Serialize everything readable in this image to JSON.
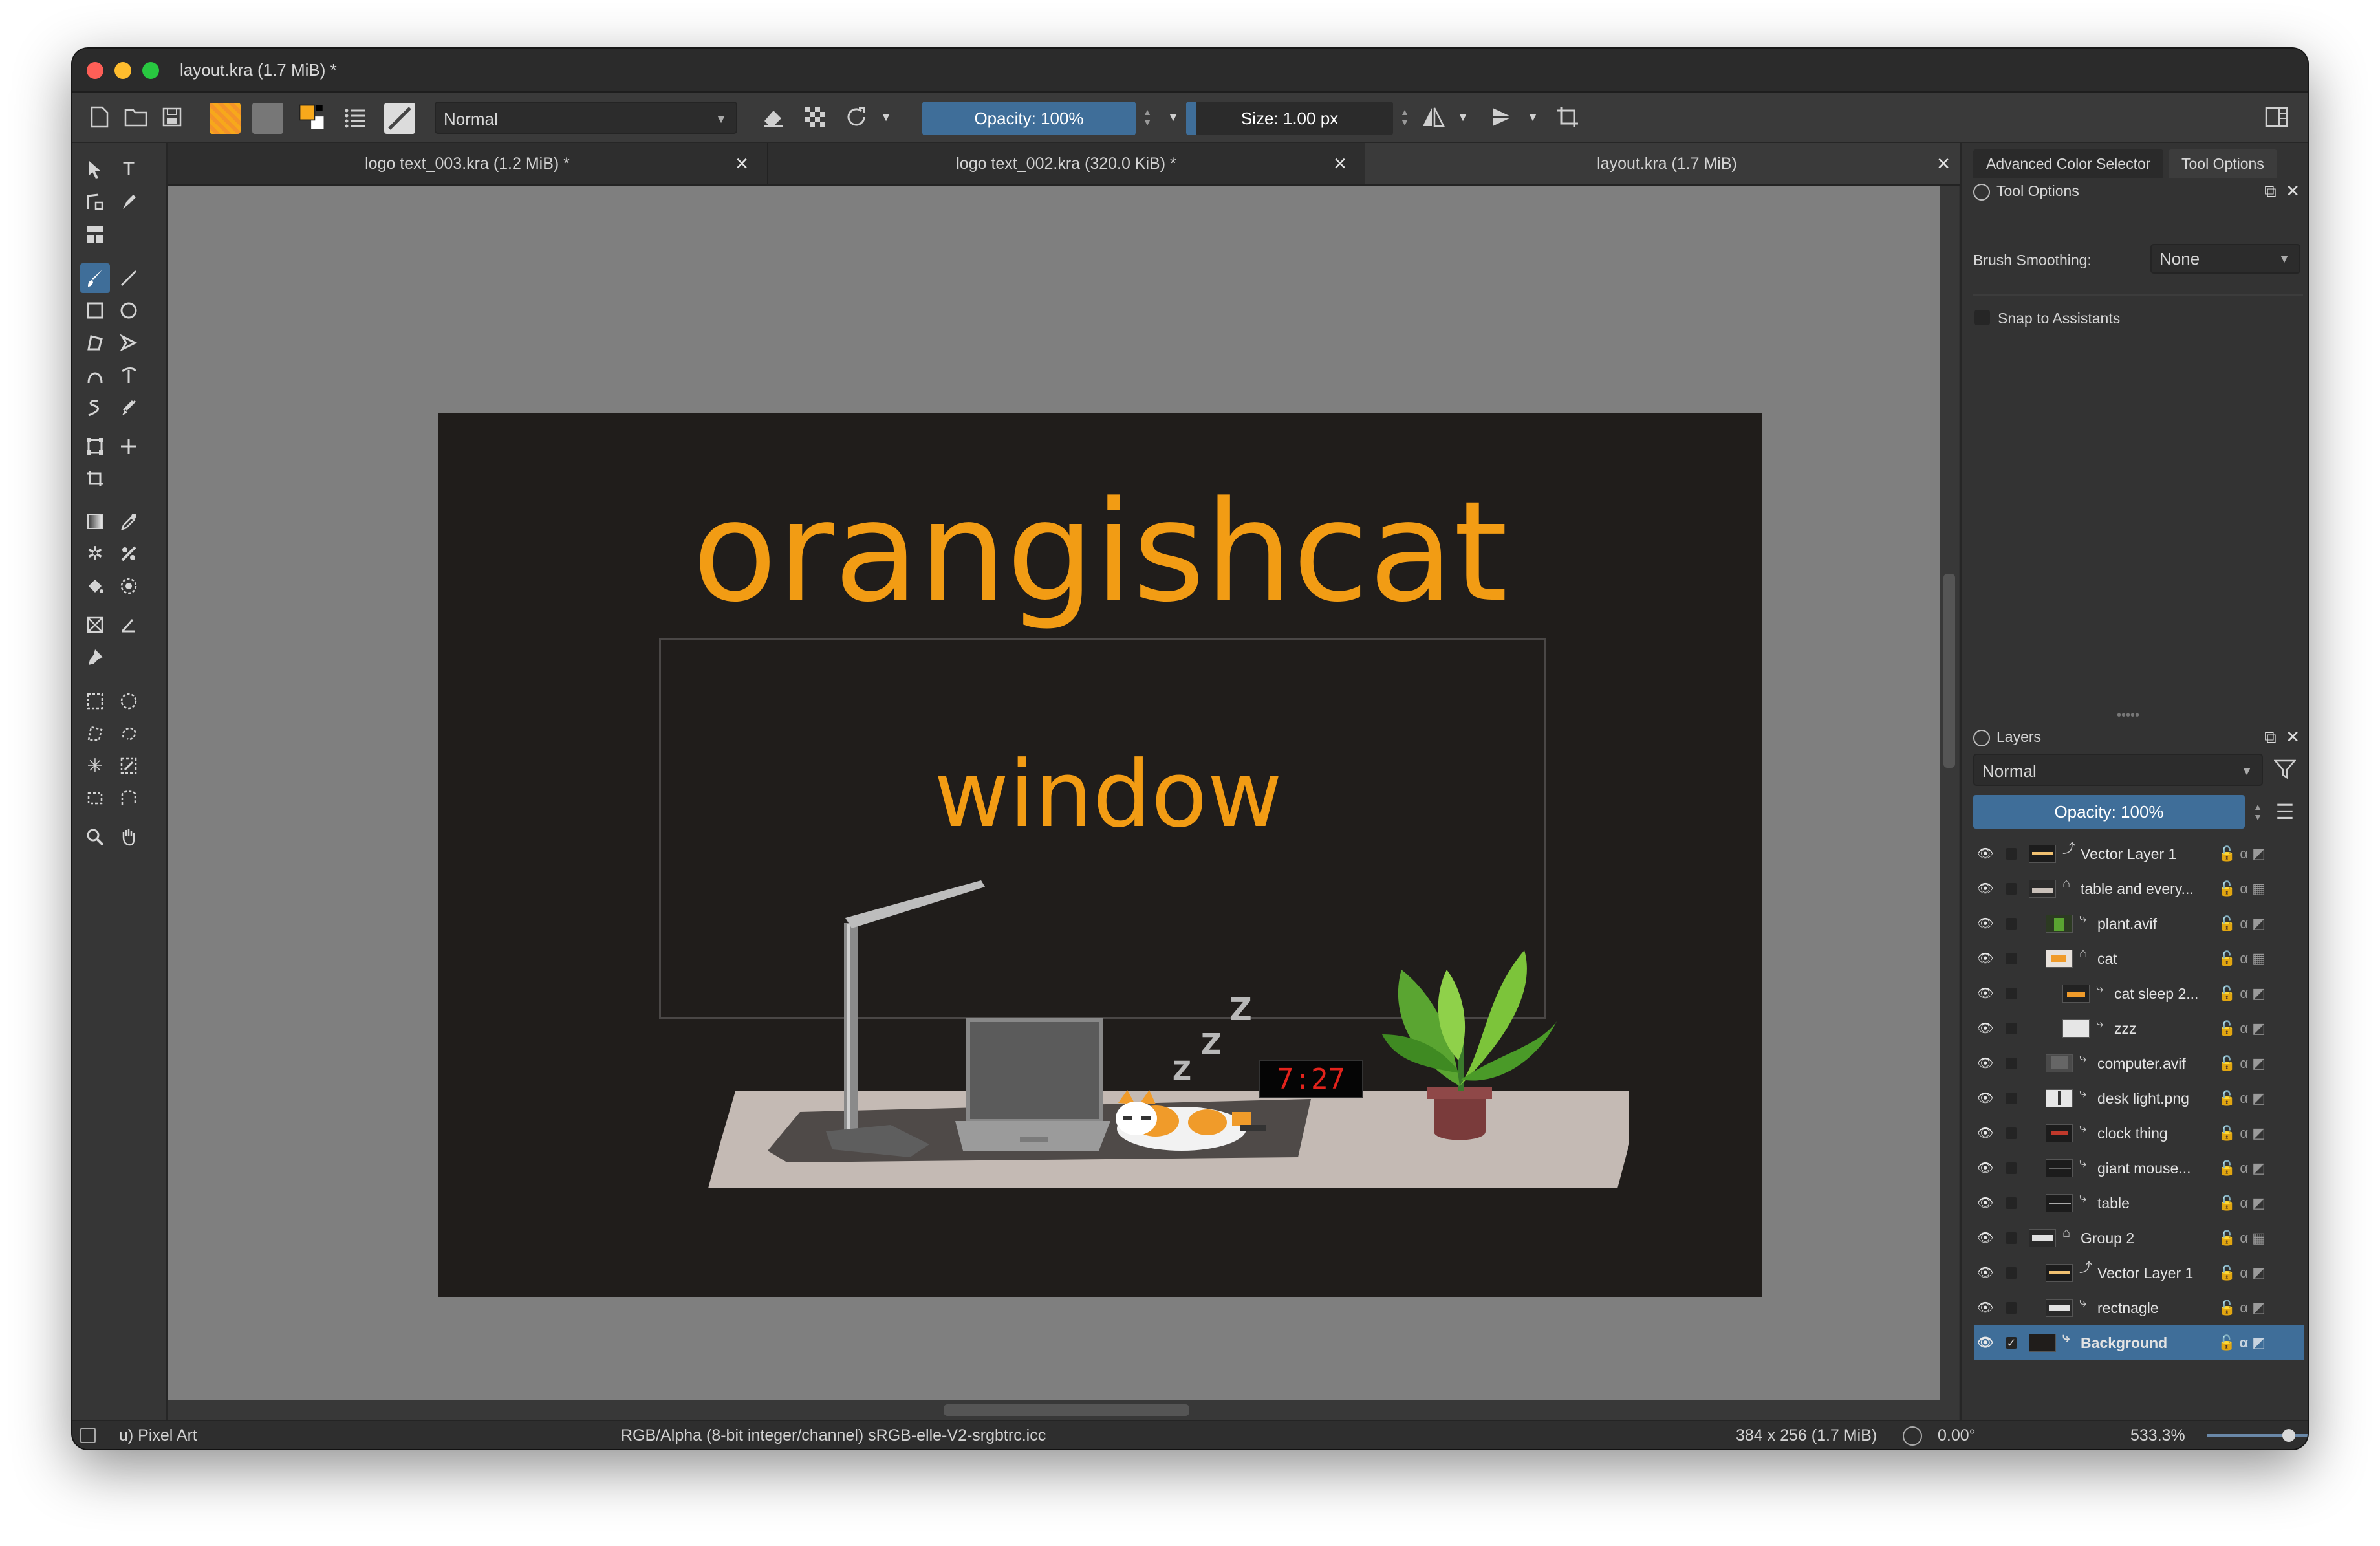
{
  "window": {
    "title": "layout.kra (1.7 MiB) *"
  },
  "toolbar": {
    "blend_mode": "Normal",
    "opacity": "Opacity: 100%",
    "opacity_value": 1.0,
    "size": "Size: 1.00 px",
    "size_value": 0.05,
    "icons": [
      "new-document-icon",
      "open-icon",
      "save-icon",
      "gradient-icon",
      "pattern-icon",
      "color-swatch-icon",
      "brush-settings-icon",
      "brush-preset-icon",
      "eraser-icon",
      "alpha-lock-icon",
      "reload-icon",
      "mirror-h-icon",
      "mirror-v-icon",
      "wrap-icon",
      "workspace-icon"
    ]
  },
  "colors": {
    "accent": "#3f6e99",
    "canvas_bg": "#7f7f7f",
    "artwork_bg": "#201d1b",
    "title_orange": "#f29c14",
    "foreground": "#f7a81b",
    "background": "#ffffff"
  },
  "tabs": [
    {
      "label": "logo text_003.kra (1.2 MiB) *",
      "active": false
    },
    {
      "label": "logo text_002.kra (320.0 KiB) *",
      "active": false
    },
    {
      "label": "layout.kra (1.7 MiB)",
      "active": true
    }
  ],
  "artwork": {
    "title": "orangishcat",
    "window_label": "window",
    "clock": "7:27",
    "zzz": "Z"
  },
  "right_panel": {
    "tabs": [
      "Advanced Color Selector",
      "Tool Options"
    ],
    "tool_options": {
      "header": "Tool Options",
      "brush_smoothing_label": "Brush Smoothing:",
      "brush_smoothing_value": "None",
      "snap_label": "Snap to Assistants"
    },
    "layers": {
      "header": "Layers",
      "blend_mode": "Normal",
      "opacity": "Opacity: 100%",
      "items": [
        {
          "name": "Vector Layer 1",
          "indent": 0,
          "selected": false
        },
        {
          "name": "table and every...",
          "indent": 0,
          "selected": false
        },
        {
          "name": "plant.avif",
          "indent": 1,
          "selected": false
        },
        {
          "name": "cat",
          "indent": 1,
          "selected": false
        },
        {
          "name": "cat sleep 2...",
          "indent": 2,
          "selected": false
        },
        {
          "name": "zzz",
          "indent": 2,
          "selected": false
        },
        {
          "name": "computer.avif",
          "indent": 1,
          "selected": false
        },
        {
          "name": "desk light.png",
          "indent": 1,
          "selected": false
        },
        {
          "name": "clock thing",
          "indent": 1,
          "selected": false
        },
        {
          "name": "giant mouse...",
          "indent": 1,
          "selected": false
        },
        {
          "name": "table",
          "indent": 1,
          "selected": false
        },
        {
          "name": "Group 2",
          "indent": 0,
          "selected": false
        },
        {
          "name": "Vector Layer 1",
          "indent": 1,
          "selected": false
        },
        {
          "name": "rectnagle",
          "indent": 1,
          "selected": false
        },
        {
          "name": "Background",
          "indent": 0,
          "selected": true
        }
      ]
    }
  },
  "statusbar": {
    "brush": "u) Pixel Art",
    "color_space": "RGB/Alpha (8-bit integer/channel)  sRGB-elle-V2-srgbtrc.icc",
    "dimensions": "384 x 256 (1.7 MiB)",
    "rotation": "0.00°",
    "zoom": "533.3%",
    "zoom_slider_value": 0.72
  }
}
